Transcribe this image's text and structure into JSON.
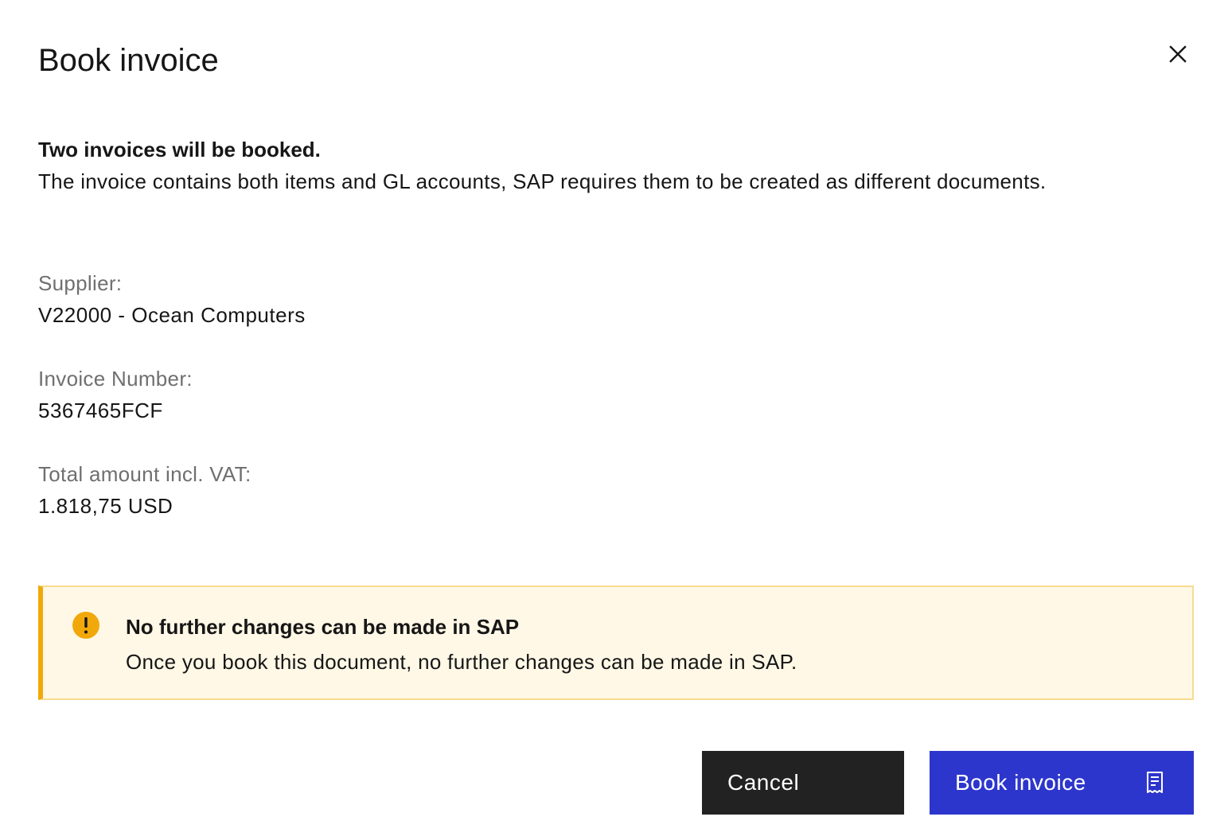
{
  "dialog": {
    "title": "Book invoice",
    "close_icon": "close-icon"
  },
  "message": {
    "lead": "Two invoices will be booked.",
    "description": "The invoice contains both items and GL accounts, SAP requires them to be created as different documents."
  },
  "fields": {
    "supplier": {
      "label": "Supplier:",
      "value": "V22000 - Ocean Computers"
    },
    "invoice_number": {
      "label": "Invoice Number:",
      "value": "5367465FCF"
    },
    "total": {
      "label": "Total amount incl. VAT:",
      "value": "1.818,75 USD"
    }
  },
  "notice": {
    "icon": "warning-icon",
    "title": "No further changes can be made in SAP",
    "text": "Once you book this document, no further changes can be made in SAP.",
    "colors": {
      "background": "#fff8e6",
      "border": "#f7dc90",
      "accent": "#f1a80a"
    }
  },
  "actions": {
    "cancel_label": "Cancel",
    "book_label": "Book invoice",
    "book_icon": "receipt-icon",
    "colors": {
      "cancel": "#222222",
      "book": "#2d36cc"
    }
  }
}
